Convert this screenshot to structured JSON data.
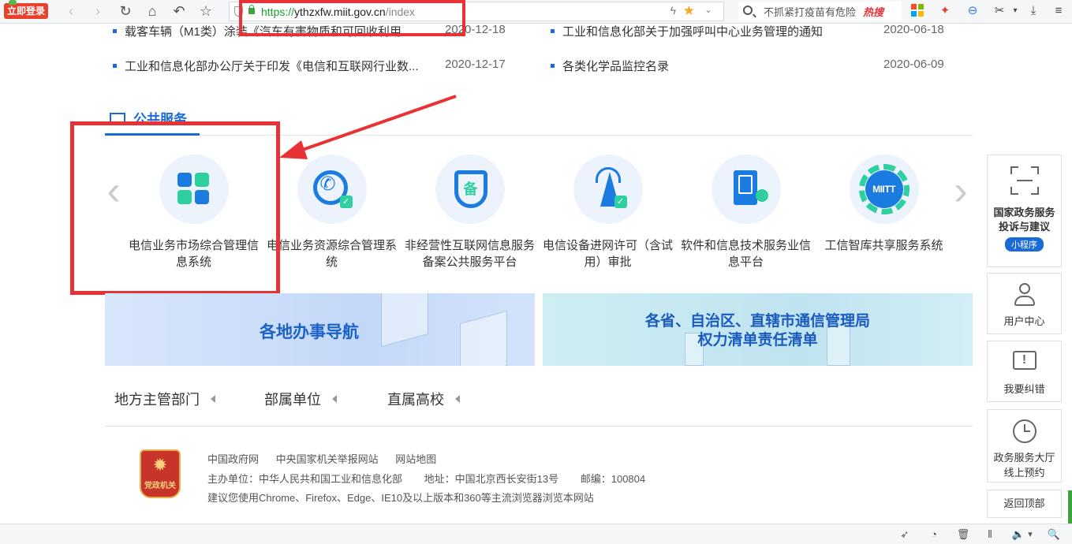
{
  "browser": {
    "login_label": "立即登录",
    "url_scheme": "https://",
    "url_host": "ythzxfw.miit.gov.cn",
    "url_path": "/index",
    "search_text": "不抓紧打疫苗有危险",
    "hot_label": "热搜"
  },
  "news": [
    {
      "title": "载客车辆（M1类）涂装《汽车有害物质和可回收利用...",
      "date": "2020-12-18"
    },
    {
      "title": "工业和信息化部关于加强呼叫中心业务管理的通知",
      "date": "2020-06-18"
    },
    {
      "title": "工业和信息化部办公厅关于印发《电信和互联网行业数...",
      "date": "2020-12-17"
    },
    {
      "title": "各类化学品监控名录",
      "date": "2020-06-09"
    }
  ],
  "section": {
    "title": "公共服务"
  },
  "services": [
    {
      "label": "电信业务市场综合管理信息系统",
      "icon": "apps-grid-icon"
    },
    {
      "label": "电信业务资源综合管理系统",
      "icon": "phone-icon"
    },
    {
      "label": "非经营性互联网信息服务备案公共服务平台",
      "icon": "shield-record-icon",
      "glyph": "备"
    },
    {
      "label": "电信设备进网许可（含试用）审批",
      "icon": "tower-icon"
    },
    {
      "label": "软件和信息技术服务业信息平台",
      "icon": "book-share-icon"
    },
    {
      "label": "工信智库共享服务系统",
      "icon": "gear-miitt-icon",
      "glyph": "MIITT"
    }
  ],
  "banners": {
    "left": "各地办事导航",
    "right_line1": "各省、自治区、直辖市通信管理局",
    "right_line2": "权力清单责任清单"
  },
  "dept_tabs": [
    "地方主管部门",
    "部属单位",
    "直属高校"
  ],
  "footer": {
    "emblem_text": "党政机关",
    "links": [
      "中国政府网",
      "中央国家机关举报网站",
      "网站地图"
    ],
    "info": [
      "主办单位：中华人民共和国工业和信息化部",
      "地址：中国北京西长安街13号",
      "邮编：100804"
    ],
    "note": "建议您使用Chrome、Firefox、Edge、IE10及以上版本和360等主流浏览器浏览本网站"
  },
  "side_panel": {
    "complaint_line1": "国家政务服务",
    "complaint_line2": "投诉与建议",
    "mini_program": "小程序",
    "user_center": "用户中心",
    "report_error": "我要纠错",
    "hall_line1": "政务服务大厅",
    "hall_line2": "线上预约",
    "back_top": "返回顶部"
  },
  "colors": {
    "accent": "#1a6ad8",
    "highlight": "#e83236",
    "teal": "#2fd0a0"
  }
}
